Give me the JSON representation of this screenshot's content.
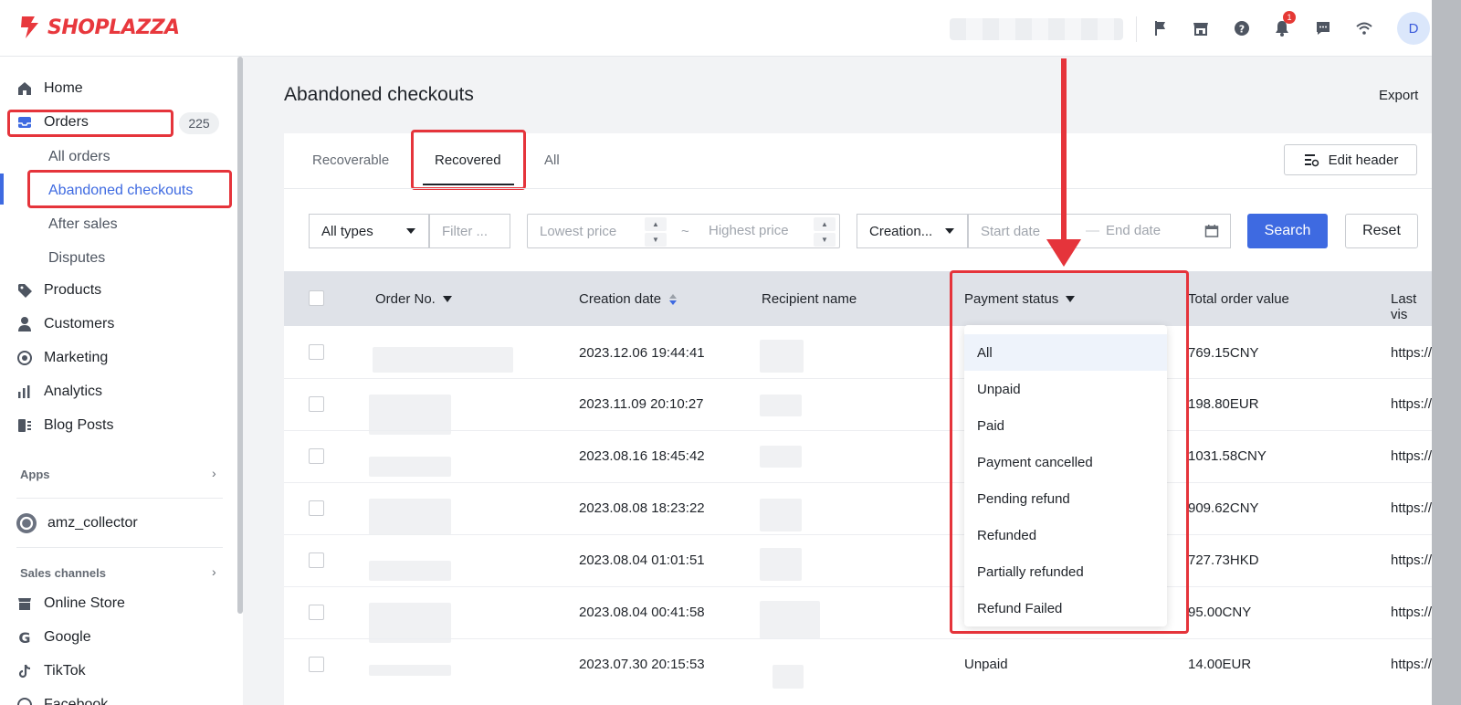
{
  "brand": {
    "name": "SHOPLAZZA",
    "accent": "#3e6ae1",
    "logo_red": "#e8383d",
    "highlight": "#e5343b"
  },
  "topbar": {
    "icons": [
      "flag-icon",
      "store-icon",
      "help-icon",
      "bell-icon",
      "chat-icon",
      "wifi-icon"
    ],
    "notification_count": "1",
    "avatar_initial": "D"
  },
  "sidebar": {
    "home": "Home",
    "orders": "Orders",
    "orders_count": "225",
    "orders_sub": [
      "All orders",
      "Abandoned checkouts",
      "After sales",
      "Disputes"
    ],
    "products": "Products",
    "customers": "Customers",
    "marketing": "Marketing",
    "analytics": "Analytics",
    "blog_posts": "Blog Posts",
    "apps_label": "Apps",
    "app_name": "amz_collector",
    "sales_channels_label": "Sales channels",
    "channels": [
      "Online Store",
      "Google",
      "TikTok",
      "Facebook"
    ]
  },
  "page": {
    "title": "Abandoned checkouts",
    "export": "Export",
    "tabs": [
      "Recoverable",
      "Recovered",
      "All"
    ],
    "active_tab": "Recovered",
    "edit_header": "Edit header"
  },
  "filters": {
    "type_value": "All types",
    "filter_placeholder": "Filter ...",
    "lowest_price_placeholder": "Lowest price",
    "price_separator": "~",
    "highest_price_placeholder": "Highest price",
    "date_type_value": "Creation...",
    "start_date_placeholder": "Start date",
    "date_separator": "—",
    "end_date_placeholder": "End date",
    "search": "Search",
    "reset": "Reset"
  },
  "table": {
    "headers": [
      "Order No.",
      "Creation date",
      "Recipient name",
      "Payment status",
      "Total order value",
      "Last vis"
    ],
    "rows": [
      {
        "date": "2023.12.06 19:44:41",
        "status": "",
        "value": "769.15CNY",
        "last": "https://h"
      },
      {
        "date": "2023.11.09 20:10:27",
        "status": "",
        "value": "198.80EUR",
        "last": "https://h"
      },
      {
        "date": "2023.08.16 18:45:42",
        "status": "",
        "value": "1031.58CNY",
        "last": "https://h"
      },
      {
        "date": "2023.08.08 18:23:22",
        "status": "",
        "value": "909.62CNY",
        "last": "https://h"
      },
      {
        "date": "2023.08.04 01:01:51",
        "status": "",
        "value": "727.73HKD",
        "last": "https://h"
      },
      {
        "date": "2023.08.04 00:41:58",
        "status": "",
        "value": "95.00CNY",
        "last": "https://h"
      },
      {
        "date": "2023.07.30 20:15:53",
        "status": "Unpaid",
        "value": "14.00EUR",
        "last": "https://h"
      }
    ]
  },
  "payment_dropdown": {
    "options": [
      "All",
      "Unpaid",
      "Paid",
      "Payment cancelled",
      "Pending refund",
      "Refunded",
      "Partially refunded",
      "Refund Failed"
    ],
    "selected": "All"
  }
}
